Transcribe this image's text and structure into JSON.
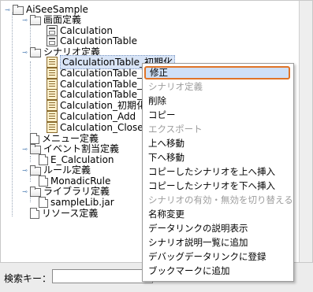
{
  "tree": [
    {
      "label": "AiSeeSample",
      "icon": "folder-icon",
      "toggle": "expanded"
    },
    {
      "label": "画面定義",
      "icon": "folder-icon",
      "toggle": "expanded"
    },
    {
      "label": "Calculation",
      "icon": "form-icon"
    },
    {
      "label": "CalculationTable",
      "icon": "form-icon"
    },
    {
      "label": "シナリオ定義",
      "icon": "folder-icon",
      "toggle": "expanded"
    },
    {
      "label": "CalculationTable_初期化",
      "icon": "scenario-icon",
      "selected": true
    },
    {
      "label": "CalculationTable_Add",
      "icon": "scenario-icon"
    },
    {
      "label": "CalculationTable_Del",
      "icon": "scenario-icon"
    },
    {
      "label": "CalculationTable_Edit",
      "icon": "scenario-icon"
    },
    {
      "label": "Calculation_初期化",
      "icon": "scenario-icon"
    },
    {
      "label": "Calculation_Add",
      "icon": "scenario-icon"
    },
    {
      "label": "Calculation_Close",
      "icon": "scenario-icon"
    },
    {
      "label": "メニュー定義",
      "icon": "document-icon"
    },
    {
      "label": "イベント割当定義",
      "icon": "folder-icon",
      "toggle": "expanded"
    },
    {
      "label": "E_Calculation",
      "icon": "document-icon"
    },
    {
      "label": "ルール定義",
      "icon": "folder-icon",
      "toggle": "expanded"
    },
    {
      "label": "MonadicRule",
      "icon": "document-icon"
    },
    {
      "label": "ライブラリ定義",
      "icon": "folder-icon",
      "toggle": "expanded"
    },
    {
      "label": "sampleLib.jar",
      "icon": "document-icon"
    },
    {
      "label": "リソース定義",
      "icon": "document-icon"
    }
  ],
  "context_menu": {
    "items": [
      {
        "label": "修正",
        "highlighted": true
      },
      {
        "label": "シナリオ定義",
        "disabled": true
      },
      {
        "label": "削除"
      },
      {
        "label": "コピー"
      },
      {
        "label": "エクスポート",
        "disabled": true
      },
      {
        "label": "上へ移動"
      },
      {
        "label": "下へ移動"
      },
      {
        "label": "コピーしたシナリオを上へ挿入"
      },
      {
        "label": "コピーしたシナリオを下へ挿入"
      },
      {
        "label": "シナリオの有効・無効を切り替える",
        "disabled": true
      },
      {
        "label": "名称変更"
      },
      {
        "label": "データリンクの説明表示"
      },
      {
        "label": "シナリオ説明一覧に追加"
      },
      {
        "label": "デバッグデータリンクに登録"
      },
      {
        "label": "ブックマークに追加"
      }
    ],
    "highlight_color": "#e07428"
  },
  "search": {
    "label": "検索キー：",
    "value": ""
  }
}
